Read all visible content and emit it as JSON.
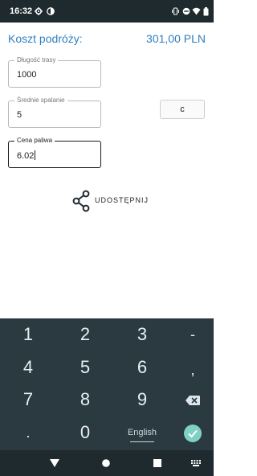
{
  "status_bar": {
    "time": "16:32",
    "left_icons": [
      "gear-icon",
      "data-saver-icon"
    ],
    "right_icons": [
      "vibrate-icon",
      "do-not-disturb-icon",
      "wifi-icon",
      "battery-icon"
    ]
  },
  "header": {
    "title": "Koszt podróży:",
    "value": "301,00 PLN"
  },
  "fields": {
    "distance": {
      "label": "Długość trasy",
      "value": "1000"
    },
    "consumption": {
      "label": "Średnie spalanie",
      "value": "5"
    },
    "price": {
      "label": "Cena paliwa",
      "value": "6.02"
    }
  },
  "c_button": {
    "label": "c"
  },
  "share": {
    "label": "UDOSTĘPNIJ",
    "icon": "share-icon"
  },
  "keyboard": {
    "row1": [
      "1",
      "2",
      "3",
      "-"
    ],
    "row2": [
      "4",
      "5",
      "6",
      ","
    ],
    "row3": [
      "7",
      "8",
      "9"
    ],
    "row4": [
      ".",
      "0"
    ],
    "language": "English",
    "backspace_icon": "backspace-icon",
    "done_icon": "check-icon"
  },
  "nav_bar": {
    "icons": [
      "back-icon",
      "home-icon",
      "recents-icon",
      "keyboard-switch-icon"
    ]
  },
  "colors": {
    "accent": "#2f7fbf",
    "keyboard_bg": "#2b3a40",
    "status_bg": "#1f2a2e",
    "done_button": "#7fd1c6"
  }
}
